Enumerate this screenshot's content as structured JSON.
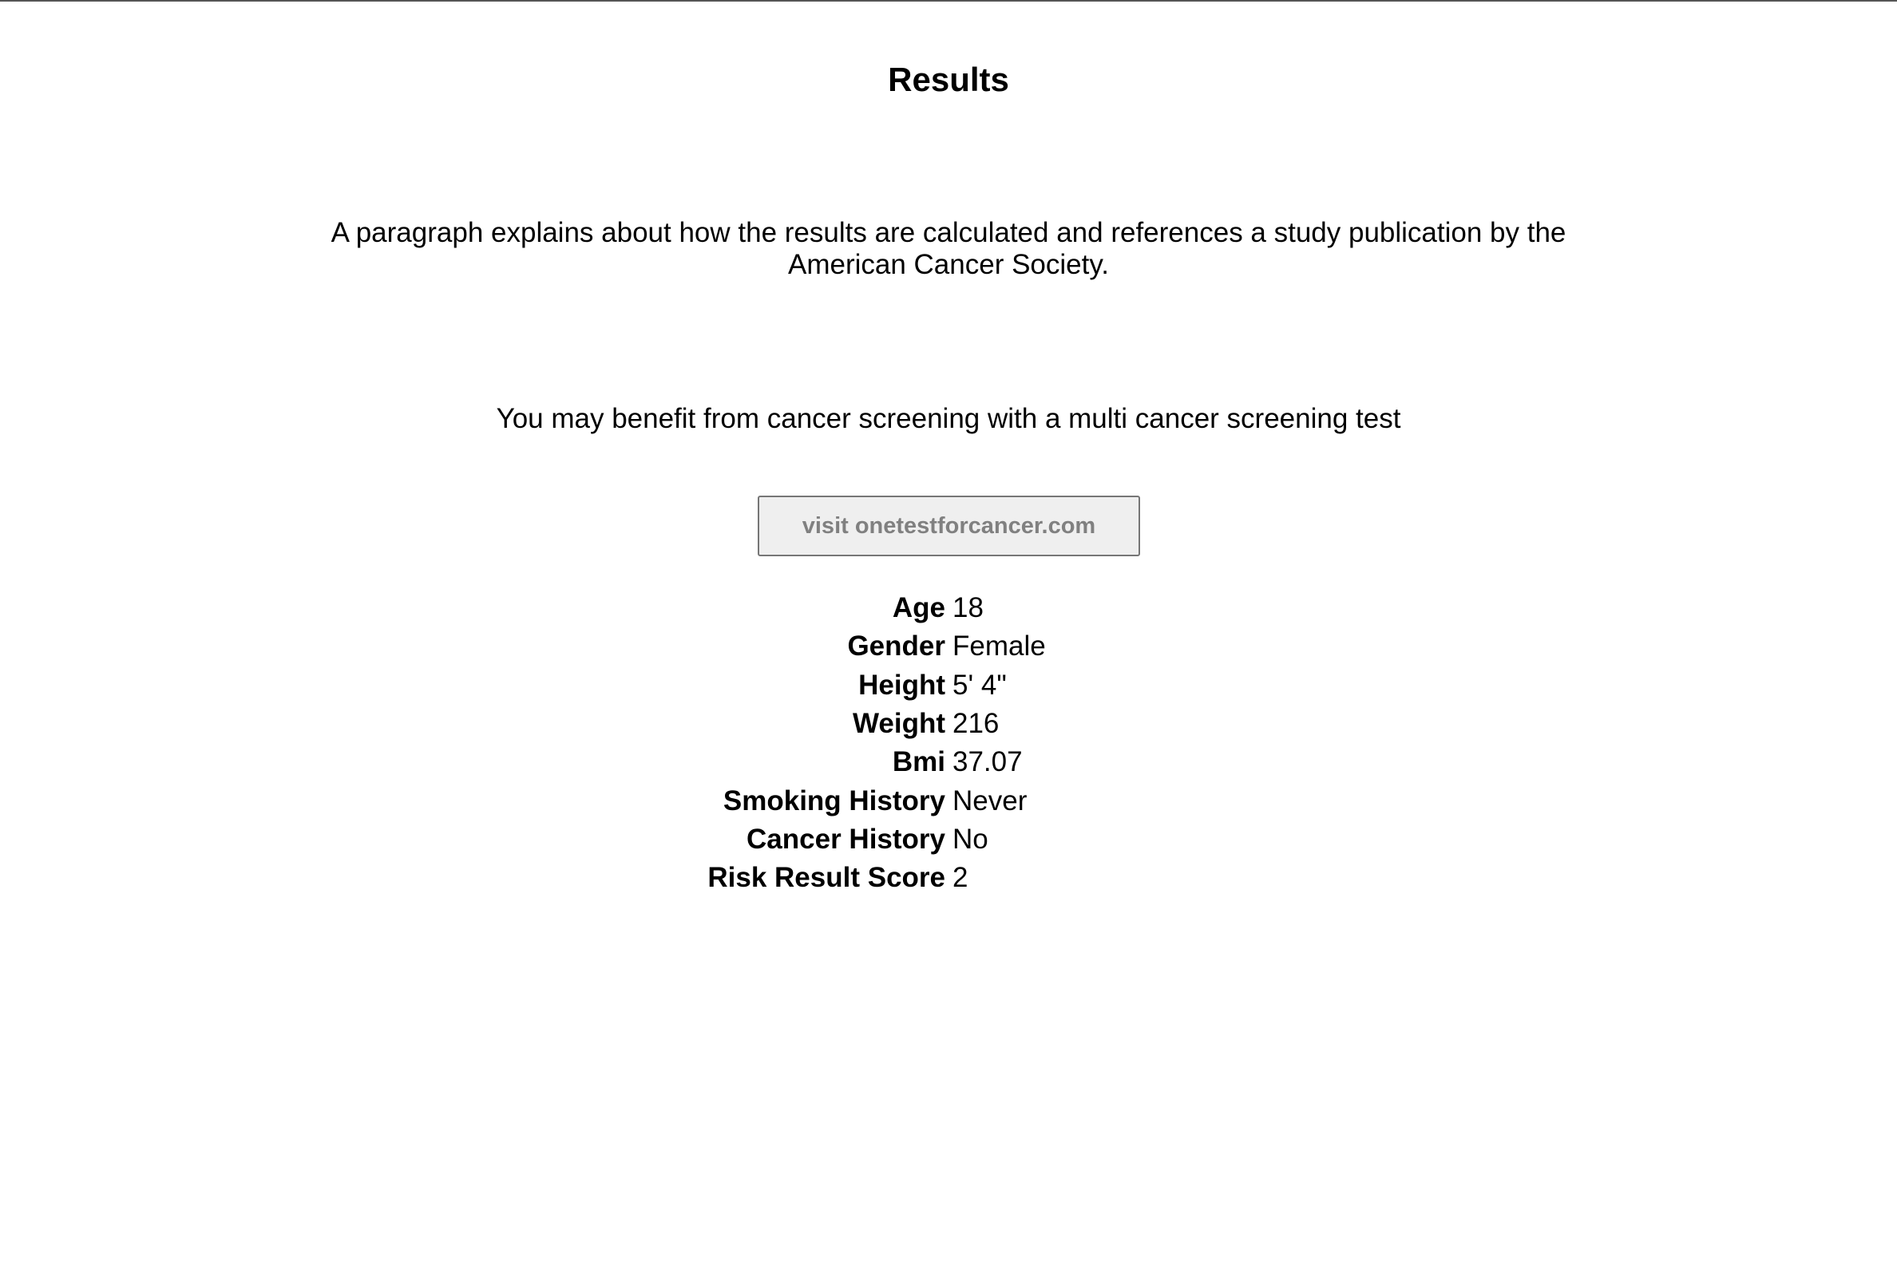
{
  "page": {
    "title": "Results",
    "explanation": "A paragraph explains about how the results are calculated and references a study publication by the American Cancer Society.",
    "recommendation": "You may benefit from cancer screening with a multi cancer screening test",
    "visit_button_label": "visit onetestforcancer.com"
  },
  "details": [
    {
      "label": "Age",
      "value": "18"
    },
    {
      "label": "Gender",
      "value": "Female"
    },
    {
      "label": "Height",
      "value": "5' 4\""
    },
    {
      "label": "Weight",
      "value": "216"
    },
    {
      "label": "Bmi",
      "value": "37.07"
    },
    {
      "label": "Smoking History",
      "value": "Never"
    },
    {
      "label": "Cancer History",
      "value": "No"
    },
    {
      "label": "Risk Result Score",
      "value": "2"
    }
  ],
  "colors": {
    "button_background": "#efefef",
    "button_border": "#767676",
    "button_text": "#808080"
  }
}
